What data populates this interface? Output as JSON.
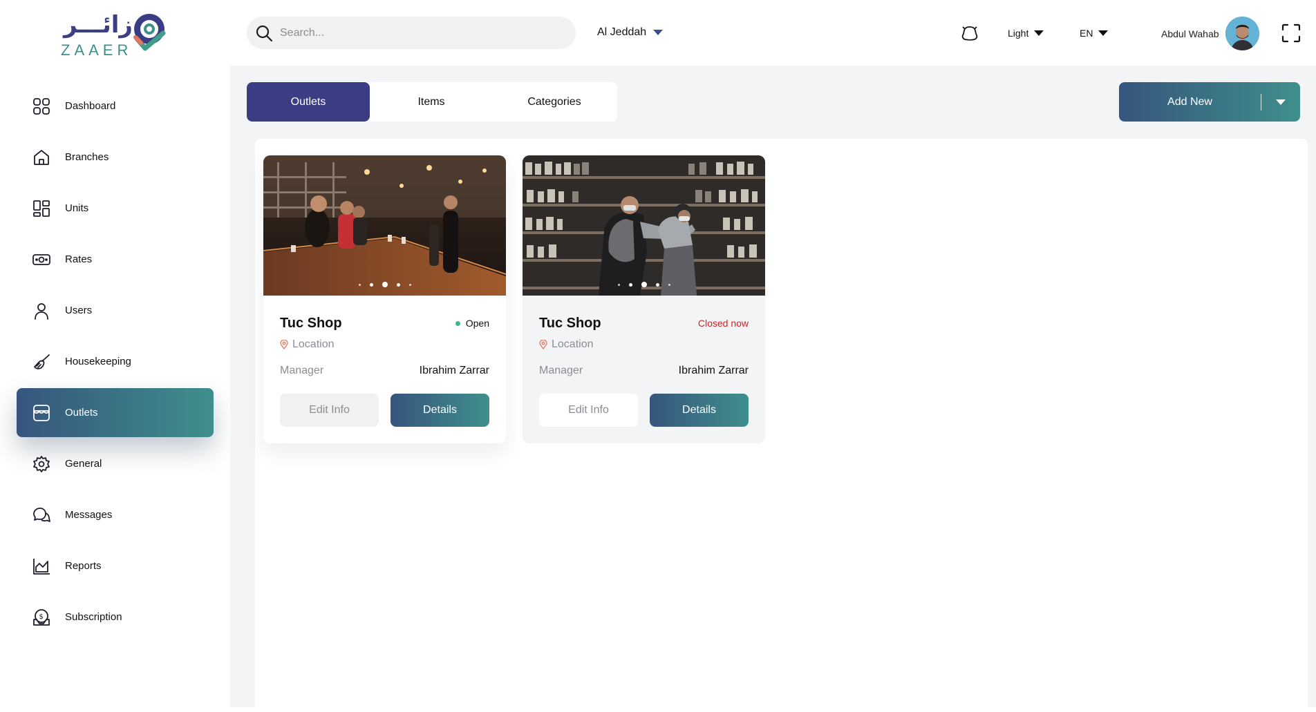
{
  "brand": {
    "name_ar": "زائـــر",
    "name_en": "ZAAER",
    "primary": "#3a3d84",
    "accent": "#3f8f8c"
  },
  "sidebar": {
    "items": [
      {
        "label": "Dashboard",
        "icon": "dashboard-icon"
      },
      {
        "label": "Branches",
        "icon": "home-icon"
      },
      {
        "label": "Units",
        "icon": "units-icon"
      },
      {
        "label": "Rates",
        "icon": "money-icon"
      },
      {
        "label": "Users",
        "icon": "user-icon"
      },
      {
        "label": "Housekeeping",
        "icon": "broom-icon"
      },
      {
        "label": "Outlets",
        "icon": "store-icon",
        "active": true
      },
      {
        "label": "General",
        "icon": "gear-icon"
      },
      {
        "label": "Messages",
        "icon": "chat-icon"
      },
      {
        "label": "Reports",
        "icon": "chart-icon"
      },
      {
        "label": "Subscription",
        "icon": "subscription-icon"
      }
    ]
  },
  "header": {
    "search_placeholder": "Search...",
    "city": "Al Jeddah",
    "theme": "Light",
    "language": "EN",
    "user_name": "Abdul Wahab"
  },
  "main": {
    "tabs": [
      {
        "label": "Outlets",
        "active": true
      },
      {
        "label": "Items"
      },
      {
        "label": "Categories"
      }
    ],
    "add_new_label": "Add New",
    "cards": [
      {
        "title": "Tuc Shop",
        "status": "Open",
        "status_color": "#39b88f",
        "location": "Location",
        "manager_label": "Manager",
        "manager_name": "Ibrahim Zarrar",
        "edit_label": "Edit Info",
        "details_label": "Details",
        "image": "cafe-photo"
      },
      {
        "title": "Tuc Shop",
        "status": "Closed now",
        "status_color": "#d32222",
        "location": "Location",
        "manager_label": "Manager",
        "manager_name": "Ibrahim Zarrar",
        "edit_label": "Edit Info",
        "details_label": "Details",
        "image": "supermarket-photo"
      }
    ]
  }
}
